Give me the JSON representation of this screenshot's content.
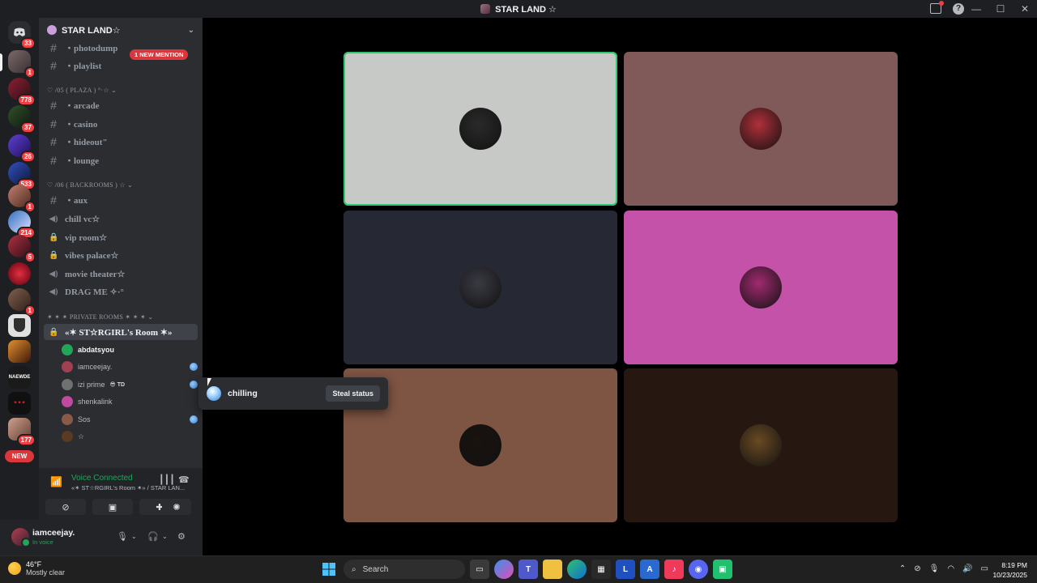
{
  "window": {
    "title": "STAR LAND ☆"
  },
  "servers": [
    {
      "badge": "33"
    },
    {
      "badge": "1"
    },
    {
      "badge": "778"
    },
    {
      "badge": "37"
    },
    {
      "badge": "26"
    },
    {
      "badge": "533"
    },
    {
      "badge": "1"
    },
    {
      "badge": "214"
    },
    {
      "badge": "5"
    },
    {
      "badge": ""
    },
    {
      "badge": "1"
    },
    {
      "badge": ""
    },
    {
      "badge": ""
    },
    {
      "badge": ""
    },
    {
      "badge": ""
    },
    {
      "badge": "177"
    }
  ],
  "rail_new": "NEW",
  "guild": {
    "name": "STAR LAND☆"
  },
  "mention_pill": "1 NEW MENTION",
  "channels_top": [
    {
      "name": "・photodump"
    },
    {
      "name": "・playlist"
    }
  ],
  "cat_plaza": "♡ /05 ( PLAZA ) °·☆ ⌄",
  "plaza_channels": [
    {
      "name": "・arcade"
    },
    {
      "name": "・casino"
    },
    {
      "name": "・hideout\""
    },
    {
      "name": "・lounge"
    }
  ],
  "cat_backrooms": "♡ /06 ( BACKROOMS ) ☆ ⌄",
  "backroom_channels": [
    {
      "name": "・aux",
      "type": "text"
    },
    {
      "name": "chill vc☆",
      "type": "voice"
    },
    {
      "name": "vip room☆",
      "type": "locked"
    },
    {
      "name": "vibes palace☆",
      "type": "locked"
    },
    {
      "name": "movie theater☆",
      "type": "voice"
    },
    {
      "name": "DRAG ME ✧·°",
      "type": "voice"
    }
  ],
  "cat_private": "✶ ✶ ✶ PRIVATE ROOMS ✶ ✶ ✶ ⌄",
  "active_room": "«✶ ST☆RGIRL's Room ✶»",
  "voice_users": [
    {
      "name": "abdatsyou",
      "tag": "",
      "strong": true
    },
    {
      "name": "iamceejay.",
      "tag": "",
      "strong": false
    },
    {
      "name": "izi prime",
      "tag": "😎 TD",
      "strong": false
    },
    {
      "name": "shenkalink",
      "tag": "",
      "strong": false
    },
    {
      "name": "Sos",
      "tag": "",
      "strong": false
    },
    {
      "name": "☆",
      "tag": "",
      "strong": false
    }
  ],
  "voice_panel": {
    "status": "Voice Connected",
    "sub": "«✶ ST☆RGIRL's Room ✶» / STAR LAN..."
  },
  "user": {
    "name": "iamceejay.",
    "status": "In voice"
  },
  "popover": {
    "text": "chilling",
    "button": "Steal status"
  },
  "tiles": [
    {
      "bg": "#c6c9c5",
      "avatar": "#2a2a2a",
      "speaking": true
    },
    {
      "bg": "#7f5a58",
      "avatar": "#b0303a",
      "speaking": false
    },
    {
      "bg": "#262833",
      "avatar": "#3a3a44",
      "speaking": false
    },
    {
      "bg": "#c452a8",
      "avatar": "#a02a70",
      "speaking": false
    },
    {
      "bg": "#7e5443",
      "avatar": "#1a120e",
      "speaking": false
    },
    {
      "bg": "#261710",
      "avatar": "#6a4a22",
      "speaking": false
    }
  ],
  "taskbar": {
    "weather_temp": "46°F",
    "weather_desc": "Mostly clear",
    "search": "Search",
    "time": "8:19 PM",
    "date": "10/23/2025"
  },
  "colors": {
    "green": "#23a559",
    "red": "#f23f43",
    "sidebar": "#2b2d31",
    "rail": "#1e1f22"
  }
}
